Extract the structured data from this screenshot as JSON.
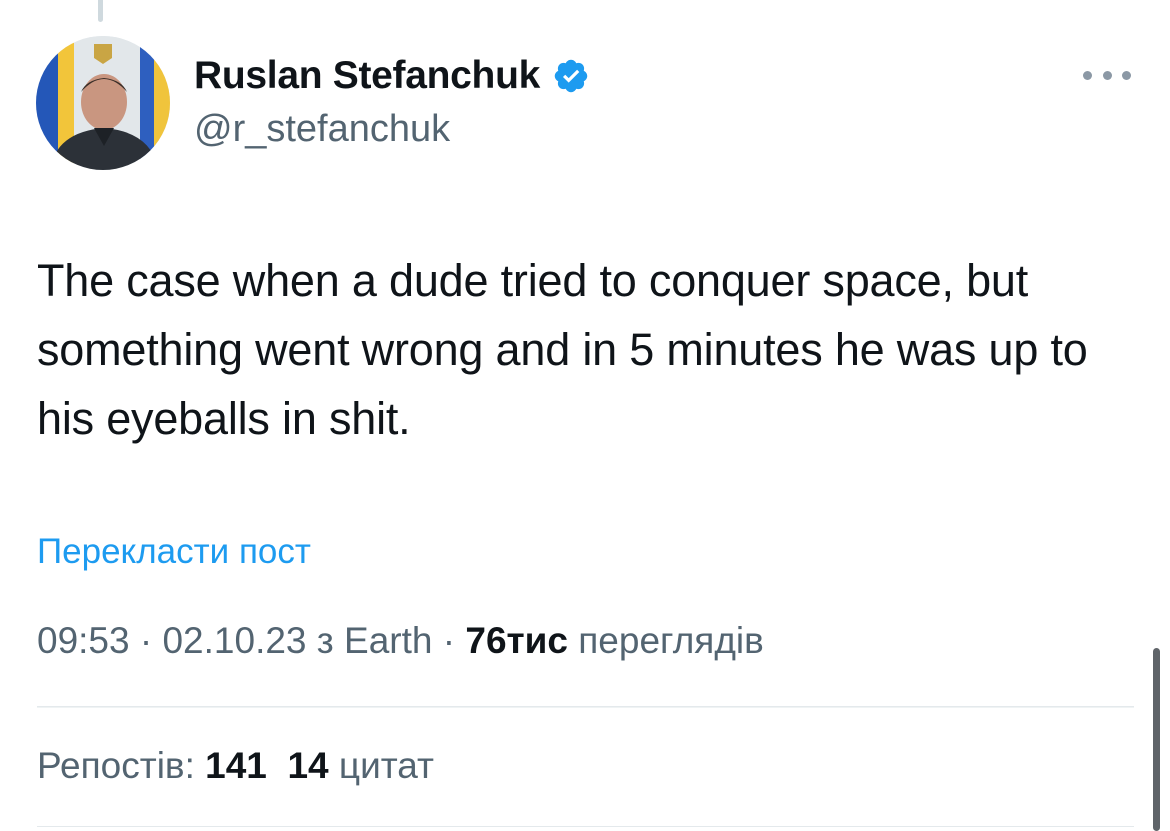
{
  "author": {
    "display_name": "Ruslan Stefanchuk",
    "handle": "@r_stefanchuk",
    "verified": true
  },
  "tweet": {
    "text": "The case when a dude tried to conquer space, but something went wrong and in 5 minutes he was up to his eyeballs in shit.",
    "translate_label": "Перекласти пост"
  },
  "meta": {
    "time": "09:53",
    "separator": "·",
    "date": "02.10.23",
    "source": "з Earth",
    "views_count": "76тис",
    "views_label": "переглядів"
  },
  "stats": {
    "reposts_label": "Репостів:",
    "reposts_count": "141",
    "quotes_count": "14",
    "quotes_label": "цитат"
  },
  "icons": {
    "verified": "verified-badge-icon",
    "more": "more-dots-icon"
  },
  "colors": {
    "accent": "#1d9bf0",
    "text": "#0f1419",
    "secondary": "#536471"
  }
}
